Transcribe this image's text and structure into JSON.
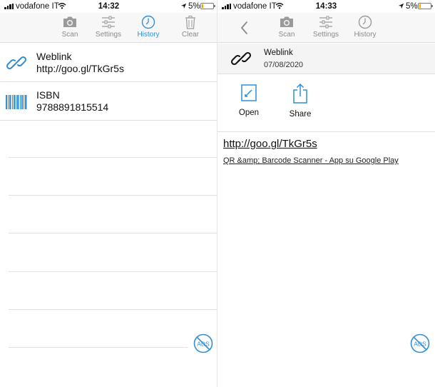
{
  "status_left": {
    "carrier": "vodafone IT",
    "time": "14:32",
    "battery": "5%"
  },
  "status_right": {
    "carrier": "vodafone IT",
    "time": "14:33",
    "battery": "5%"
  },
  "history_toolbar": {
    "scan": "Scan",
    "settings": "Settings",
    "history": "History",
    "clear": "Clear",
    "active": "History"
  },
  "history_items": [
    {
      "icon": "link-icon",
      "type": "Weblink",
      "value": "http://goo.gl/TkGr5s"
    },
    {
      "icon": "barcode-icon",
      "type": "ISBN",
      "value": "9788891815514"
    }
  ],
  "detail_toolbar": {
    "scan": "Scan",
    "settings": "Settings",
    "history": "History"
  },
  "detail": {
    "type": "Weblink",
    "date": "07/08/2020",
    "open_label": "Open",
    "share_label": "Share",
    "link": "http://goo.gl/TkGr5s",
    "page_title": "QR &amp; Barcode Scanner - App su Google Play"
  },
  "ads_label": "ADS",
  "colors": {
    "accent": "#2f8fd8",
    "inactive": "#8a8a8a",
    "battery_low": "#f2a400"
  }
}
